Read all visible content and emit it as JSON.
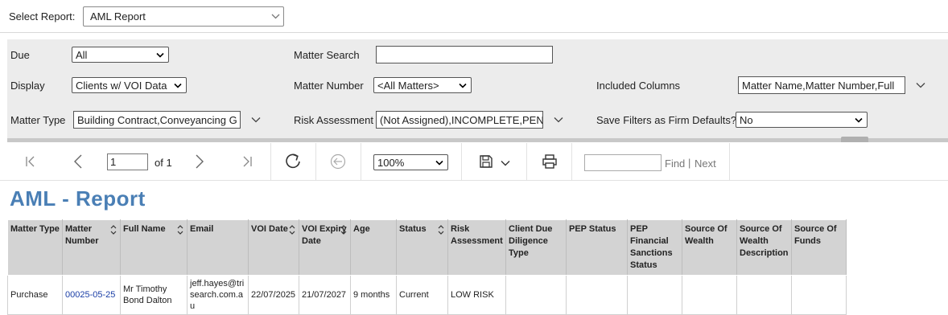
{
  "header": {
    "select_report_label": "Select Report:",
    "select_report_value": "AML Report"
  },
  "filters": {
    "due_label": "Due",
    "due_value": "All",
    "display_label": "Display",
    "display_value": "Clients w/ VOI Data",
    "matter_type_label": "Matter Type",
    "matter_type_value": "Building Contract,Conveyancing G",
    "matter_search_label": "Matter Search",
    "matter_search_value": "",
    "matter_number_label": "Matter Number",
    "matter_number_value": "<All Matters>",
    "risk_assessment_label": "Risk Assessment",
    "risk_assessment_value": "(Not Assigned),INCOMPLETE,PEND",
    "included_columns_label": "Included Columns",
    "included_columns_value": "Matter Name,Matter Number,Full",
    "save_filters_label": "Save Filters as Firm Defaults?",
    "save_filters_value": "No"
  },
  "toolbar": {
    "page_value": "1",
    "of_pages": "of 1",
    "zoom_value": "100%",
    "find_placeholder": "",
    "find_label": "Find",
    "divider": "|",
    "next_label": "Next"
  },
  "report": {
    "title": "AML - Report",
    "columns": [
      "Matter Type",
      "Matter Number",
      "Full Name",
      "Email",
      "VOI Date",
      "VOI Expiry Date",
      "Age",
      "Status",
      "Risk Assessment",
      "Client Due Diligence Type",
      "PEP Status",
      "PEP Financial Sanctions Status",
      "Source Of Wealth",
      "Source Of Wealth Description",
      "Source Of Funds"
    ],
    "rows": [
      {
        "matter_type": "Purchase",
        "matter_number": "00025-05-25",
        "full_name": "Mr Timothy Bond Dalton",
        "email": "jeff.hayes@trisearch.com.au",
        "voi_date": "22/07/2025",
        "voi_expiry_date": "21/07/2027",
        "age": "9 months",
        "status": "Current",
        "risk_assessment": "LOW RISK",
        "client_due_diligence_type": "",
        "pep_status": "",
        "pep_financial_sanctions_status": "",
        "source_of_wealth": "",
        "source_of_wealth_description": "",
        "source_of_funds": ""
      }
    ]
  }
}
